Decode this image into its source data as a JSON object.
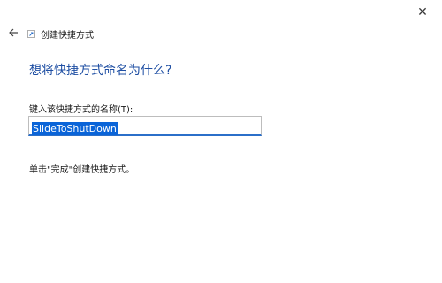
{
  "window": {
    "close_symbol": "✕",
    "title": "创建快捷方式"
  },
  "icons": {
    "back": "back-arrow-icon",
    "close": "close-icon",
    "wizard": "shortcut-icon"
  },
  "page": {
    "heading": "想将快捷方式命名为什么?",
    "field_label": "键入该快捷方式的名称(T):",
    "name_value": "SlideToShutDown",
    "hint": "单击\"完成\"创建快捷方式。"
  },
  "colors": {
    "heading": "#1f4fa3",
    "selection": "#0a64d8",
    "input_focus_border": "#2b6fc9"
  }
}
